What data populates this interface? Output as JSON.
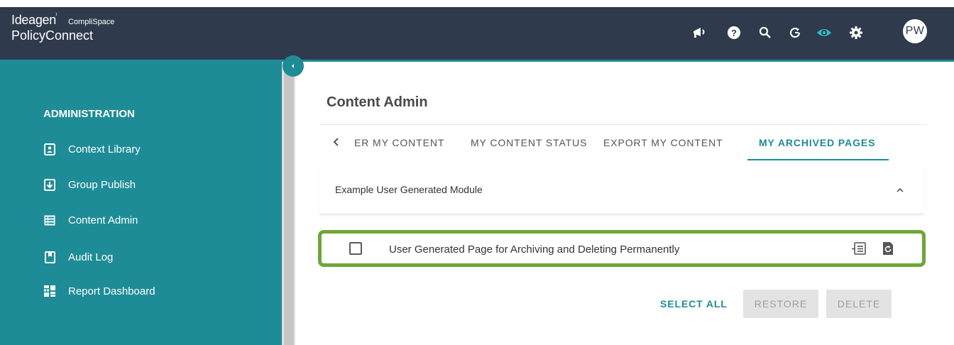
{
  "header": {
    "brand": "Ideagen",
    "brand_mark": "⁾",
    "brand_sub": "CompliSpace",
    "product": "PolicyConnect",
    "icons": [
      "megaphone-icon",
      "help-icon",
      "search-icon",
      "refresh-icon",
      "eye-icon",
      "gear-icon"
    ],
    "avatar_initials": "PW"
  },
  "sidebar": {
    "section": "ADMINISTRATION",
    "items": [
      {
        "label": "Context Library",
        "icon": "context-library-icon"
      },
      {
        "label": "Group Publish",
        "icon": "group-publish-icon"
      },
      {
        "label": "Content Admin",
        "icon": "content-admin-icon"
      },
      {
        "label": "Audit Log",
        "icon": "audit-log-icon"
      },
      {
        "label": "Report Dashboard",
        "icon": "report-dashboard-icon"
      }
    ]
  },
  "main": {
    "title": "Content Admin",
    "tabs": [
      {
        "label": "ER MY CONTENT",
        "active": false
      },
      {
        "label": "MY CONTENT STATUS",
        "active": false
      },
      {
        "label": "EXPORT MY CONTENT",
        "active": false
      },
      {
        "label": "MY ARCHIVED PAGES",
        "active": true
      }
    ],
    "module": {
      "title": "Example User Generated Module"
    },
    "pages": [
      {
        "title": "User Generated Page for Archiving and Deleting Permanently",
        "checked": false
      }
    ],
    "actions": {
      "select_all": "SELECT ALL",
      "restore": "RESTORE",
      "delete": "DELETE"
    }
  },
  "colors": {
    "header_bg": "#2f3b4c",
    "accent": "#1e8c96",
    "highlight_border": "#6fa637",
    "disabled_bg": "#e3e3e3"
  }
}
